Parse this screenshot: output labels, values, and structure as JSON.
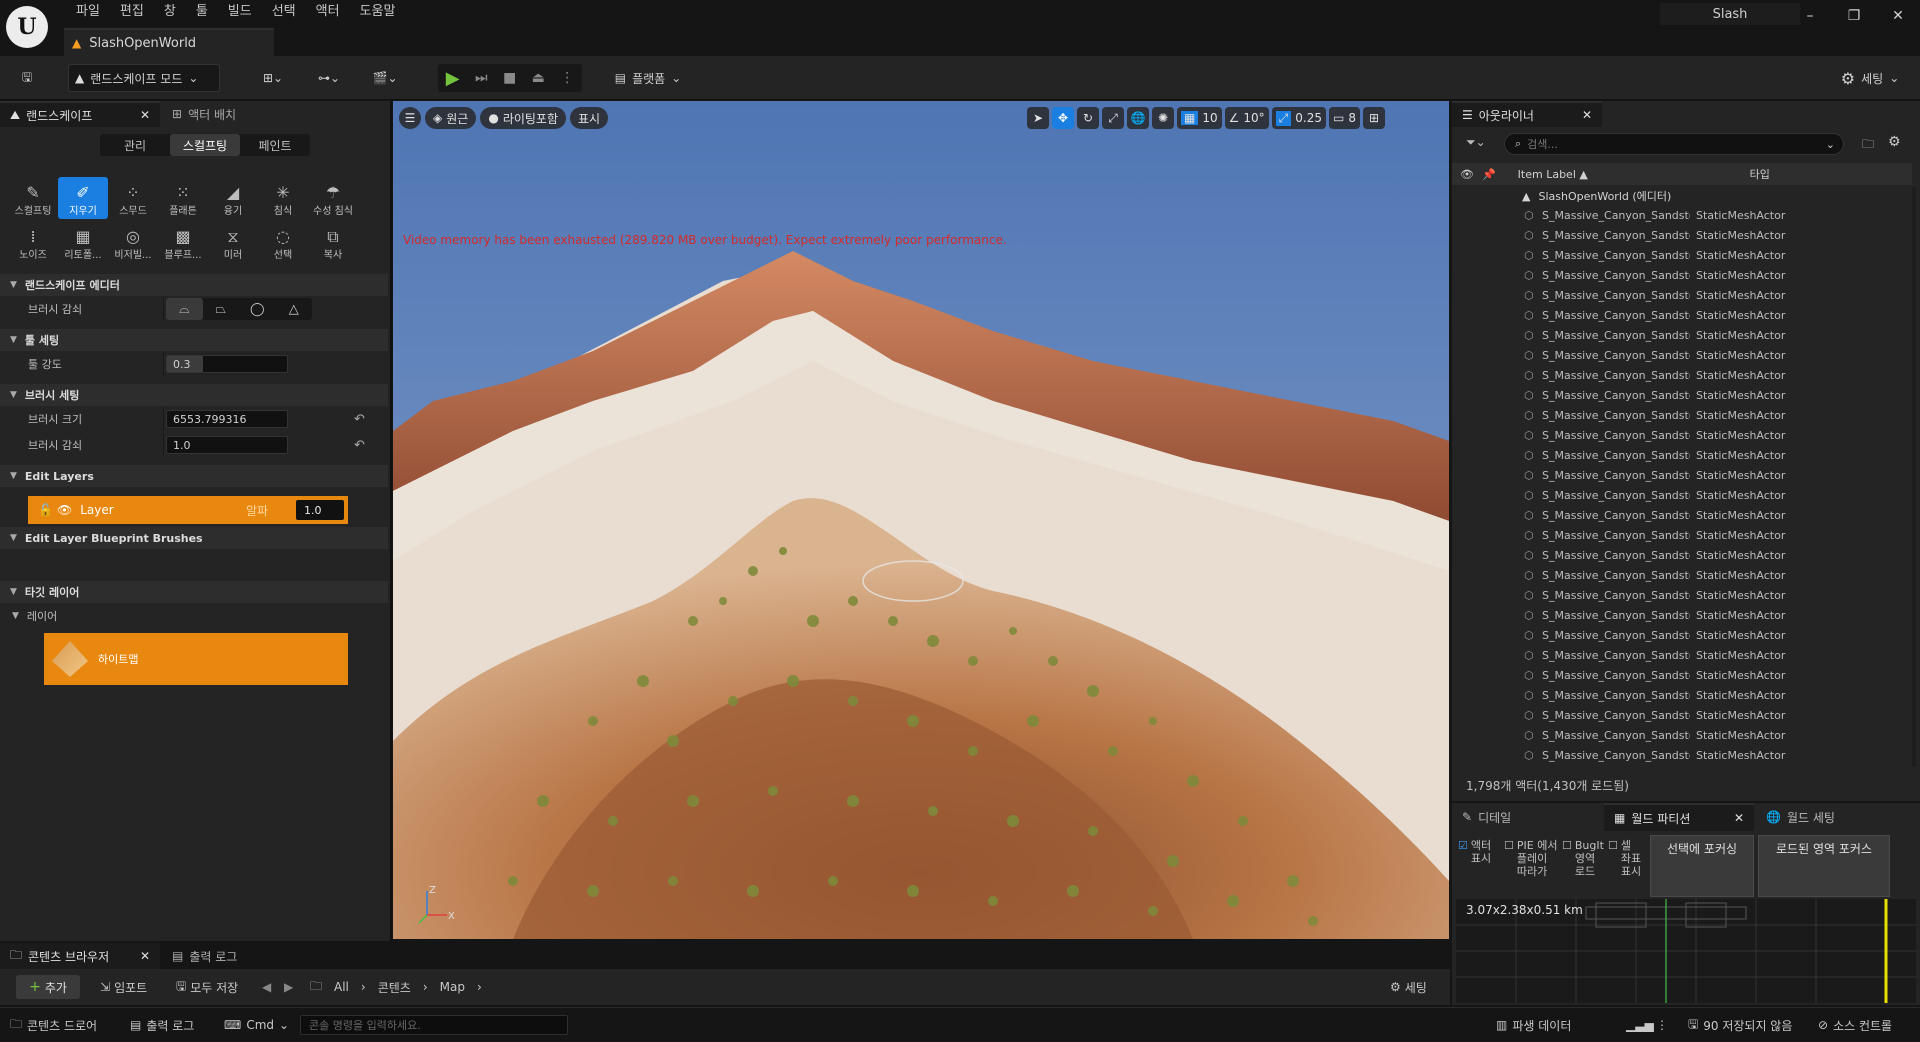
{
  "menu": [
    "파일",
    "편집",
    "창",
    "툴",
    "빌드",
    "선택",
    "액터",
    "도움말"
  ],
  "document_tab": "SlashOpenWorld",
  "project_name": "Slash",
  "toolbar": {
    "mode": "랜드스케이프 모드",
    "platforms": "플랫폼",
    "settings": "세팅"
  },
  "left_panel": {
    "tab_landscape": "랜드스케이프",
    "tab_place_actors": "액터 배치",
    "segments": [
      "관리",
      "스컬프팅",
      "페인트"
    ],
    "tools": [
      {
        "label": "스컬프팅",
        "icon": "sculpt-icon"
      },
      {
        "label": "지우기",
        "icon": "erase-icon",
        "selected": true
      },
      {
        "label": "스무드",
        "icon": "smooth-icon"
      },
      {
        "label": "플래튼",
        "icon": "flatten-icon"
      },
      {
        "label": "융기",
        "icon": "ramp-icon"
      },
      {
        "label": "침식",
        "icon": "erosion-icon"
      },
      {
        "label": "수성 침식",
        "icon": "hydro-erosion-icon"
      },
      {
        "label": "노이즈",
        "icon": "noise-icon"
      },
      {
        "label": "리토폴...",
        "icon": "retopologize-icon"
      },
      {
        "label": "비저빌...",
        "icon": "visibility-icon"
      },
      {
        "label": "블루프...",
        "icon": "blueprint-icon"
      },
      {
        "label": "미러",
        "icon": "mirror-icon"
      },
      {
        "label": "선택",
        "icon": "select-icon"
      },
      {
        "label": "복사",
        "icon": "copy-icon"
      }
    ],
    "editor_section": "랜드스케이프 에디터",
    "brush_falloff_type_label": "브러시 감쇠",
    "tool_settings_section": "툴 세팅",
    "tool_strength_label": "툴 강도",
    "tool_strength_value": "0.3",
    "tool_strength_fraction": 0.3,
    "brush_settings_section": "브러시 세팅",
    "brush_size_label": "브러시 크기",
    "brush_size_value": "6553.799316",
    "brush_falloff_label": "브러시 감쇠",
    "brush_falloff_value": "1.0",
    "edit_layers_section": "Edit Layers",
    "layer_name": "Layer",
    "layer_alpha_label": "알파",
    "layer_alpha_value": "1.0",
    "blueprint_brushes_section": "Edit Layer Blueprint Brushes",
    "target_layers_section": "타깃 레이어",
    "layers_label": "레이어",
    "heightmap_label": "하이트맵"
  },
  "viewport": {
    "perspective": "원근",
    "lighting": "라이팅포함",
    "show": "표시",
    "grid_snap": "10",
    "rotation_snap": "10°",
    "scale_snap": "0.25",
    "camera_speed": "8",
    "warning": "Video memory has been exhausted (289.820 MB over budget). Expect extremely poor performance.",
    "axis_z": "Z",
    "axis_x": "X"
  },
  "outliner": {
    "tab": "아웃라이너",
    "search_placeholder": "검색...",
    "col_label": "Item Label ▲",
    "col_type": "타입",
    "root": "SlashOpenWorld (에디터)",
    "row_name": "S_Massive_Canyon_Sandstone_Cliff_vjr",
    "row_type": "StaticMeshActor",
    "row_count_visible": 28,
    "count_text": "1,798개 액터(1,430개 로드됨)"
  },
  "world_partition": {
    "tab_details": "디테일",
    "tab_partition": "월드 파티션",
    "tab_world_settings": "월드 세팅",
    "opt_actor": "액터 표시",
    "opt_pie": "PIE 에서 플레이 따라가",
    "opt_bugit": "BugIt 영역 로드",
    "opt_coords": "셀 좌표 표시",
    "focus_selection": "선택에 포커싱",
    "focus_loaded": "로드된 영역 포커스",
    "world_size": "3.07x2.38x0.51 km"
  },
  "content_browser": {
    "tab": "콘텐츠 브라우저",
    "tab_output": "출력 로그",
    "add": "추가",
    "import": "임포트",
    "save_all": "모두 저장",
    "path": [
      "All",
      "콘텐츠",
      "Map"
    ],
    "settings": "세팅"
  },
  "statusbar": {
    "content_drawer": "콘텐츠 드로어",
    "output_log": "출력 로그",
    "cmd": "Cmd",
    "cmd_placeholder": "콘솔 명령을 입력하세요.",
    "derived_data": "파생 데이터",
    "unsaved": "90 저장되지 않음",
    "source_control": "소스 컨트롤"
  },
  "colors": {
    "accent_blue": "#1a7fe0",
    "layer_orange": "#e8880f",
    "play_green": "#74c43e",
    "warning_red": "#d32a2a"
  }
}
